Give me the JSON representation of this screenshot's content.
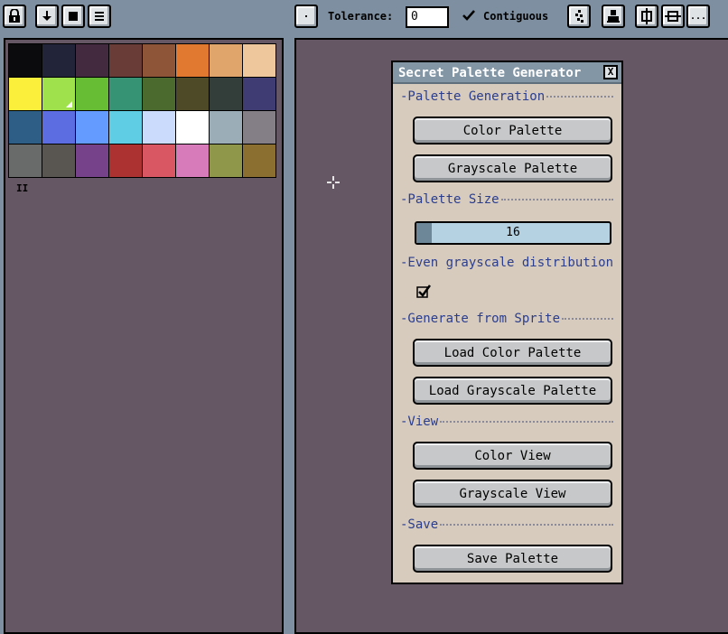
{
  "toolbar": {
    "lock_icon": "lock-icon",
    "import_icon": "download-icon",
    "save_icon": "square-icon",
    "menu_icon": "menu-icon",
    "pixel_mode_icon": "dot-icon",
    "tolerance_label": "Tolerance:",
    "tolerance_value": "0",
    "contiguous_label": "Contiguous",
    "contiguous_checked": true,
    "more_label": "..."
  },
  "palette": {
    "swatches": [
      "#0b0b0d",
      "#22243a",
      "#432a3e",
      "#6a3c38",
      "#8e5538",
      "#e17a30",
      "#e0a56a",
      "#efc79c",
      "#fbef3b",
      "#9fe14d",
      "#67bd33",
      "#369373",
      "#4a6a2e",
      "#4e4a28",
      "#333d3a",
      "#3f3c74",
      "#2e5d86",
      "#5b6de1",
      "#639bff",
      "#5fcde4",
      "#cbdbfc",
      "#ffffff",
      "#9badb7",
      "#847e87",
      "#696a6a",
      "#595652",
      "#76428a",
      "#ac3232",
      "#d95763",
      "#d77bba",
      "#8f974a",
      "#8a6f30"
    ],
    "selected_index": 9,
    "name": "II"
  },
  "dialog": {
    "title": "Secret Palette Generator",
    "close_label": "X",
    "sections": {
      "palette_generation": "-Palette Generation",
      "palette_size": "-Palette Size",
      "even_grayscale": "-Even grayscale distribution",
      "generate_from_sprite": "-Generate from Sprite",
      "view": "-View",
      "save": "-Save"
    },
    "buttons": {
      "color_palette": "Color Palette",
      "grayscale_palette": "Grayscale Palette",
      "load_color_palette": "Load Color Palette",
      "load_grayscale_palette": "Load Grayscale Palette",
      "color_view": "Color View",
      "grayscale_view": "Grayscale View",
      "save_palette": "Save Palette"
    },
    "palette_size": {
      "value": "16",
      "fill_fraction": 0.08
    },
    "even_grayscale_checked": true
  },
  "colors": {
    "background": "#7d8fa0",
    "panel": "#655764",
    "dialog_bg": "#d7cbbe",
    "dialog_title": "#8296a6",
    "section_text": "#2b3e8e"
  }
}
